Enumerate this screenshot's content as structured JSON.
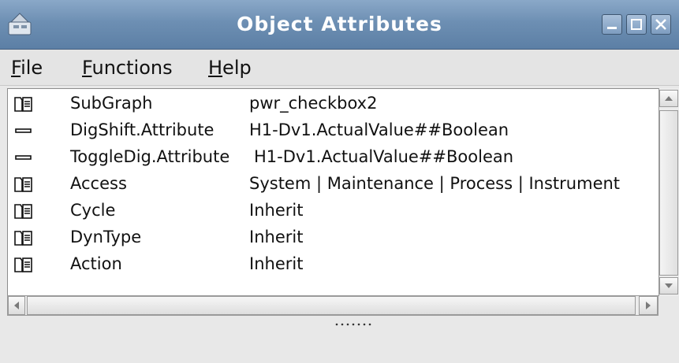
{
  "window": {
    "title": "Object Attributes",
    "colors": {
      "titlebar": "#6d8fb3",
      "background": "#e8e8e8",
      "list": "#ffffff"
    }
  },
  "menu": {
    "items": [
      {
        "label": "File"
      },
      {
        "label": "Functions"
      },
      {
        "label": "Help"
      }
    ]
  },
  "attributes": [
    {
      "icon": "folder-icon",
      "name": "SubGraph",
      "value": "pwr_checkbox2"
    },
    {
      "icon": "dash-icon",
      "name": "DigShift.Attribute",
      "value": "H1-Dv1.ActualValue##Boolean"
    },
    {
      "icon": "dash-icon",
      "name": "ToggleDig.Attribute",
      "value": "H1-Dv1.ActualValue##Boolean"
    },
    {
      "icon": "folder-icon",
      "name": "Access",
      "value": "System | Maintenance | Process | Instrument"
    },
    {
      "icon": "folder-icon",
      "name": "Cycle",
      "value": "Inherit"
    },
    {
      "icon": "folder-icon",
      "name": "DynType",
      "value": "Inherit"
    },
    {
      "icon": "folder-icon",
      "name": "Action",
      "value": "Inherit"
    }
  ]
}
